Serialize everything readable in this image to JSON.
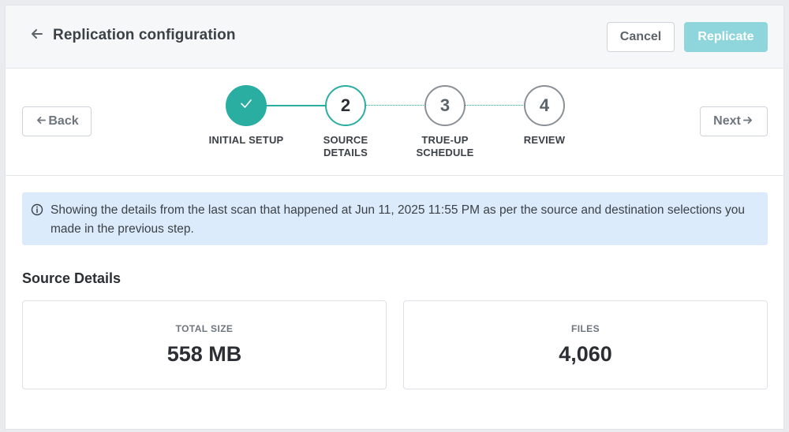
{
  "header": {
    "title": "Replication configuration",
    "cancel_label": "Cancel",
    "replicate_label": "Replicate"
  },
  "nav": {
    "back_label": "Back",
    "next_label": "Next"
  },
  "stepper": {
    "steps": [
      {
        "number": "✓",
        "label": "INITIAL SETUP",
        "status": "completed"
      },
      {
        "number": "2",
        "label": "SOURCE\nDETAILS",
        "status": "current"
      },
      {
        "number": "3",
        "label": "TRUE-UP\nSCHEDULE",
        "status": "upcoming"
      },
      {
        "number": "4",
        "label": "REVIEW",
        "status": "upcoming"
      }
    ]
  },
  "info": {
    "icon": "info-circle-icon",
    "text": "Showing the details from the last scan that happened at Jun 11, 2025 11:55 PM as per the source and destination selections you made in the previous step."
  },
  "source_details": {
    "title": "Source Details",
    "cards": [
      {
        "label": "TOTAL SIZE",
        "value": "558 MB"
      },
      {
        "label": "FILES",
        "value": "4,060"
      }
    ]
  },
  "colors": {
    "accent": "#2aaea1",
    "replicate_disabled": "#8fd6dc",
    "info_bg": "#dcebfb"
  }
}
